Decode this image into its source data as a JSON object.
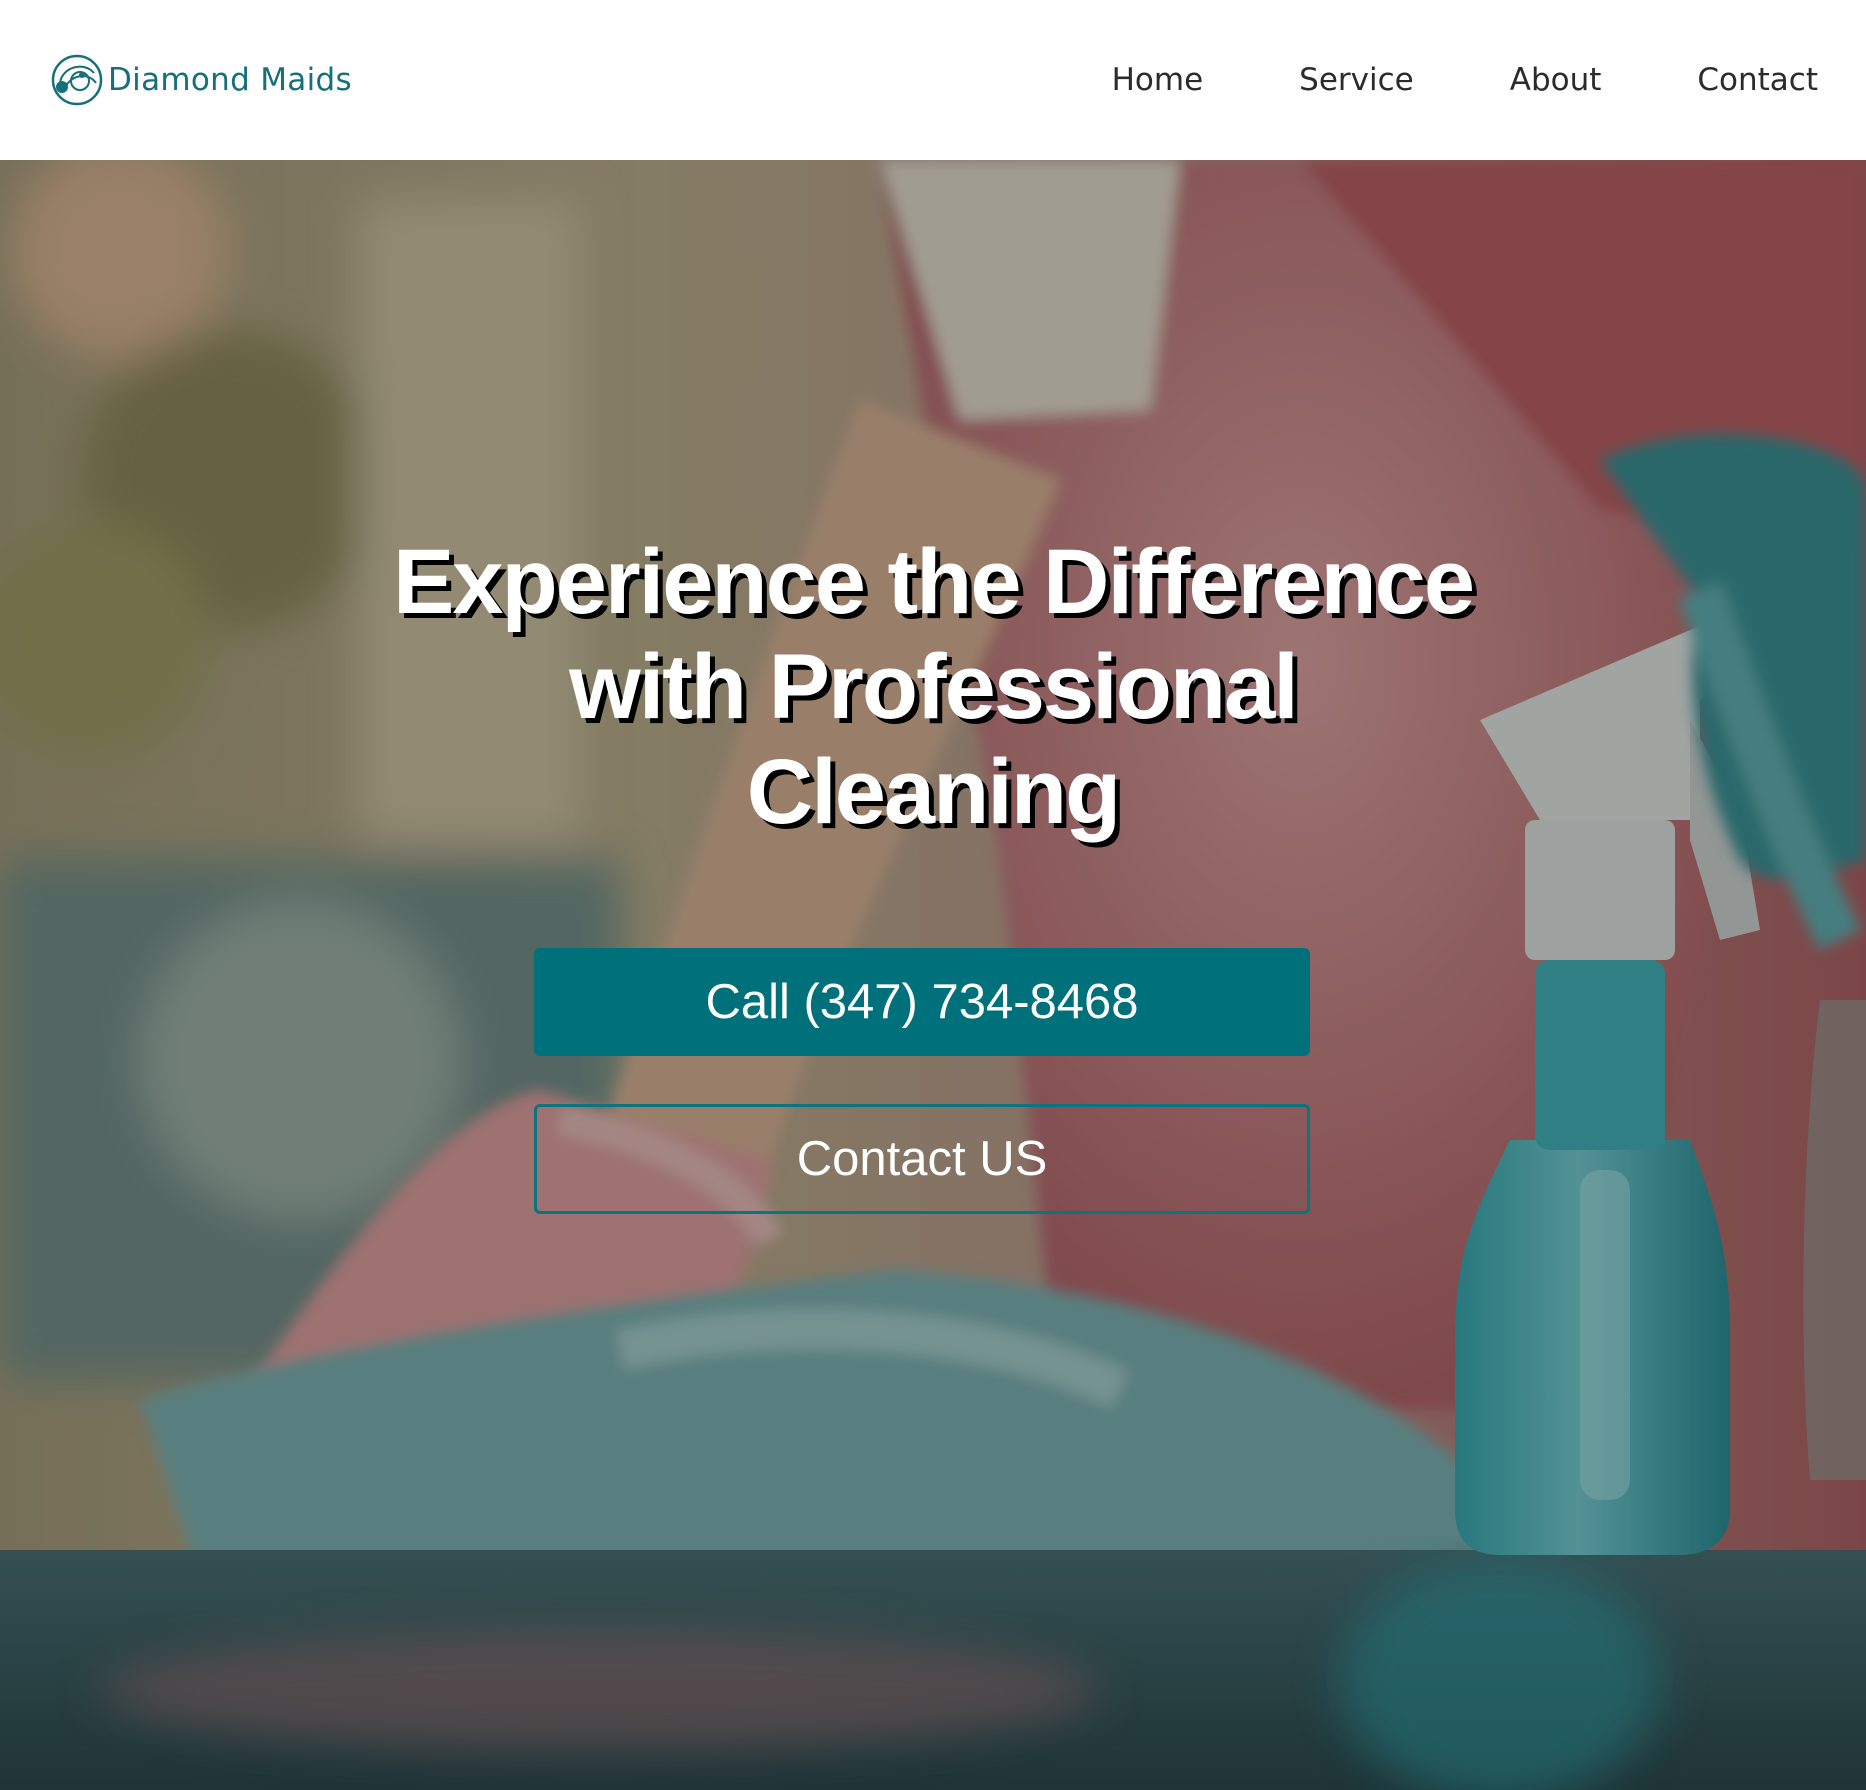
{
  "brand": {
    "name": "Diamond Maids",
    "color": "#16707a"
  },
  "nav": {
    "items": [
      {
        "label": "Home"
      },
      {
        "label": "Service"
      },
      {
        "label": "About"
      },
      {
        "label": "Contact"
      }
    ]
  },
  "hero": {
    "title_lines": [
      "Experience the Difference",
      "with Professional",
      "Cleaning"
    ],
    "background_image": "cleaning-photo",
    "primary_button": {
      "label": "Call (347) 734-8468",
      "color": "#00707b"
    },
    "secondary_button": {
      "label": "Contact US",
      "border_color": "#0a7480"
    }
  }
}
